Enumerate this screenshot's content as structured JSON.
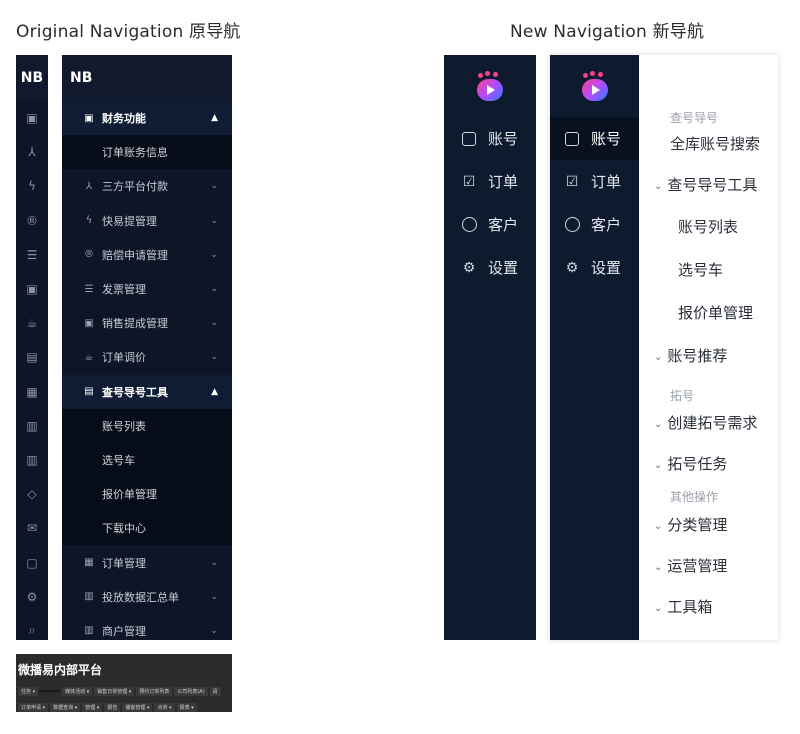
{
  "headings": {
    "original": "Original Navigation 原导航",
    "new": "New Navigation 新导航"
  },
  "original": {
    "mini_logo": "NB",
    "mini_icons": [
      "invoice-icon",
      "network-icon",
      "bolt-icon",
      "registered-icon",
      "list-icon",
      "invoice-icon",
      "cup-icon",
      "terminal-icon",
      "receipt-icon",
      "document-icon",
      "document-icon",
      "tag-icon",
      "mail-icon",
      "search-doc-icon",
      "gear-icon",
      "search-icon"
    ],
    "full_logo": "NB",
    "menu": [
      {
        "label": "财务功能",
        "type": "parent",
        "open": true,
        "icon": "invoice-icon",
        "chevron": "up"
      },
      {
        "label": "订单账务信息",
        "type": "child"
      },
      {
        "label": "三方平台付款",
        "type": "parent",
        "icon": "network-icon",
        "chevron": "down"
      },
      {
        "label": "快易提管理",
        "type": "parent",
        "icon": "bolt-icon",
        "chevron": "down"
      },
      {
        "label": "赔偿申请管理",
        "type": "parent",
        "icon": "registered-icon",
        "chevron": "down"
      },
      {
        "label": "发票管理",
        "type": "parent",
        "icon": "list-icon",
        "chevron": "down"
      },
      {
        "label": "销售提成管理",
        "type": "parent",
        "icon": "invoice-icon",
        "chevron": "down"
      },
      {
        "label": "订单调价",
        "type": "parent",
        "icon": "cup-icon",
        "chevron": "down"
      },
      {
        "label": "查号导号工具",
        "type": "parent",
        "open": true,
        "icon": "terminal-icon",
        "chevron": "up"
      },
      {
        "label": "账号列表",
        "type": "child"
      },
      {
        "label": "选号车",
        "type": "child"
      },
      {
        "label": "报价单管理",
        "type": "child"
      },
      {
        "label": "下载中心",
        "type": "child"
      },
      {
        "label": "订单管理",
        "type": "parent",
        "icon": "receipt-icon",
        "chevron": "down"
      },
      {
        "label": "投放数据汇总单",
        "type": "parent",
        "icon": "document-icon",
        "chevron": "down"
      },
      {
        "label": "商户管理",
        "type": "parent",
        "icon": "document-icon",
        "chevron": "down"
      }
    ],
    "bottom_bar": {
      "title": "微播易内部平台",
      "row1": [
        "任务 ▾",
        "",
        "媒体活动 ▾",
        "销售日常管理 ▾",
        "预约订单列表",
        "公司列表(A)",
        "请"
      ],
      "row2": [
        "订单申请 ▾",
        "数据查询 ▾",
        "管理 ▾",
        "报告",
        "播客管理 ▾",
        "点资 ▾",
        "报表 ▾"
      ]
    }
  },
  "new": {
    "mini_items": [
      {
        "label": "账号",
        "icon": "account-icon"
      },
      {
        "label": "订单",
        "icon": "order-icon"
      },
      {
        "label": "客户",
        "icon": "customer-icon"
      },
      {
        "label": "设置",
        "icon": "gear-icon"
      }
    ],
    "rail_items": [
      {
        "label": "账号",
        "icon": "account-icon",
        "active": true
      },
      {
        "label": "订单",
        "icon": "order-icon"
      },
      {
        "label": "客户",
        "icon": "customer-icon"
      },
      {
        "label": "设置",
        "icon": "gear-icon"
      }
    ],
    "panel": {
      "group1": "查号导号",
      "search_all": "全库账号搜索",
      "tool": "查号导号工具",
      "tool_children": [
        "账号列表",
        "选号车",
        "报价单管理"
      ],
      "recommend": "账号推荐",
      "group2": "拓号",
      "create_demand": "创建拓号需求",
      "task": "拓号任务",
      "group3": "其他操作",
      "category": "分类管理",
      "operations": "运营管理",
      "toolbox": "工具箱"
    }
  }
}
